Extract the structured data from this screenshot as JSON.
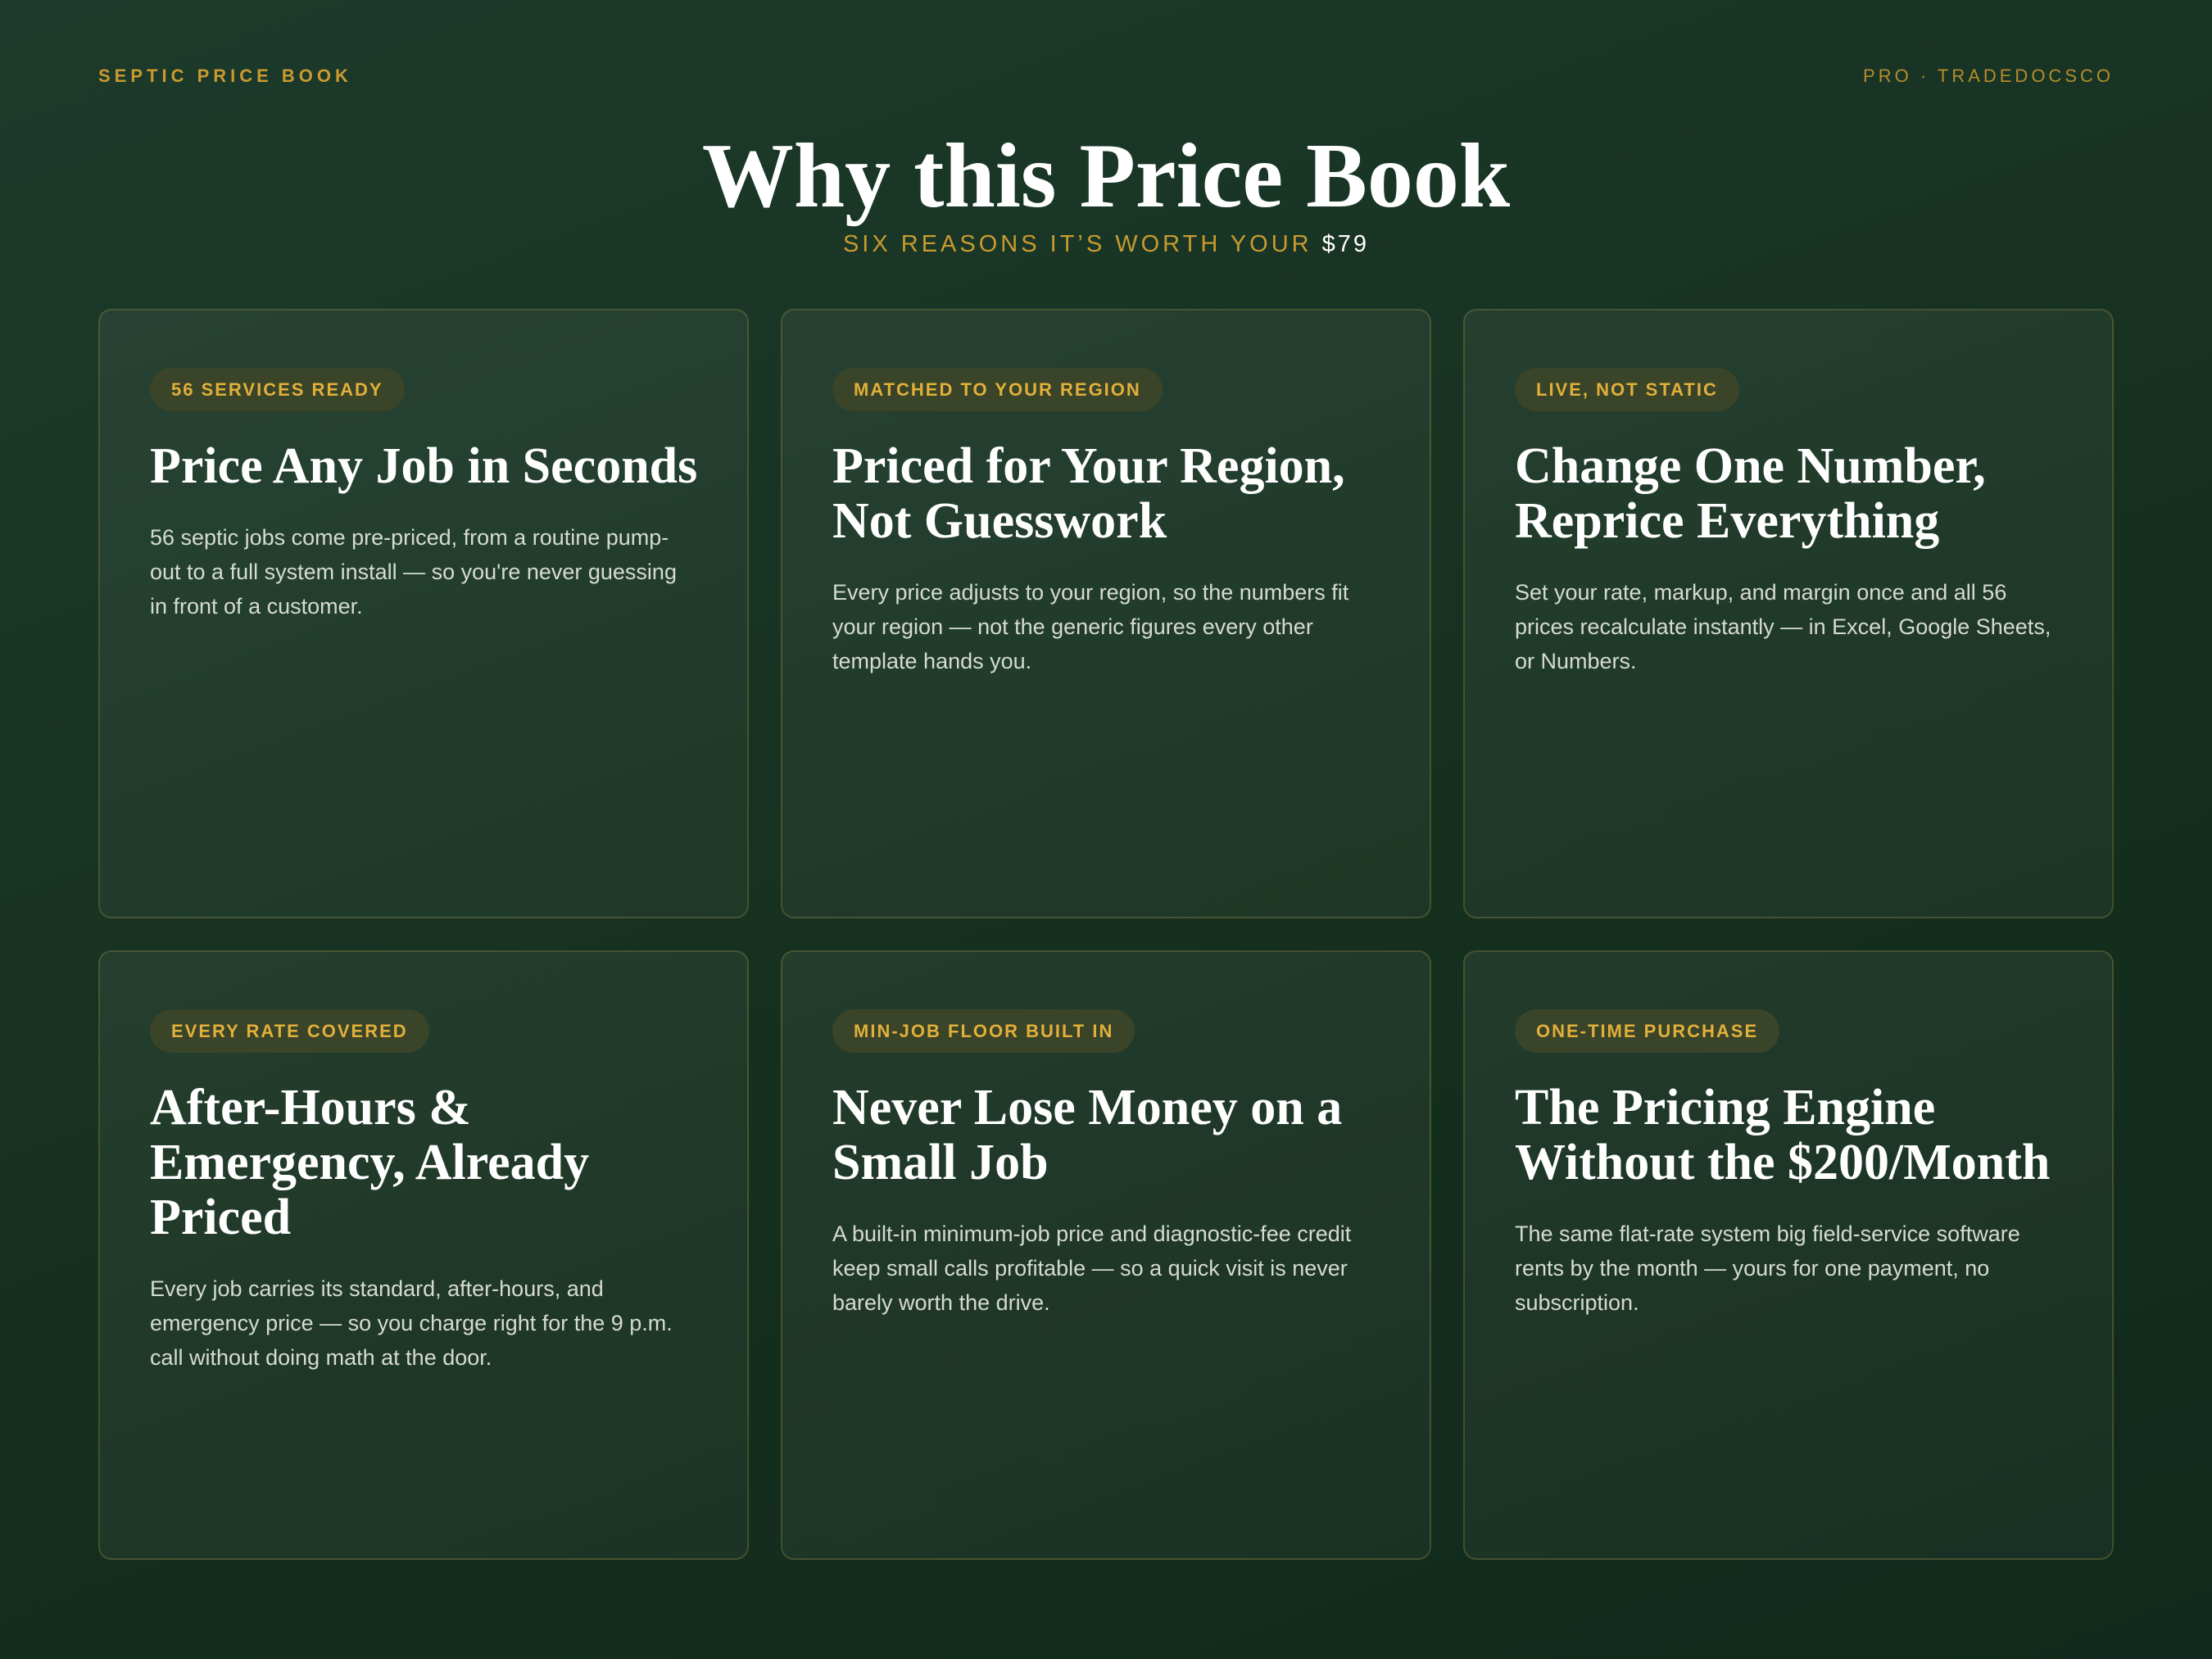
{
  "header": {
    "brand": "SEPTIC PRICE BOOK",
    "meta": "PRO · TRADEDOCSCO"
  },
  "hero": {
    "title": "Why this Price Book",
    "subtitle": "SIX REASONS IT’S WORTH YOUR",
    "price": "$79"
  },
  "colors": {
    "accent_gold": "#c99a2e",
    "badge_text": "#e2b03a",
    "background": "#1c3a2b"
  },
  "cards": [
    {
      "badge": "56 SERVICES READY",
      "title": "Price Any Job in Seconds",
      "body": "56 septic jobs come pre-priced, from a routine pump-out to a full system install — so you're never guessing in front of a customer."
    },
    {
      "badge": "MATCHED TO YOUR REGION",
      "title": "Priced for Your Region, Not Guesswork",
      "body": "Every price adjusts to your region, so the numbers fit your region — not the generic figures every other template hands you."
    },
    {
      "badge": "LIVE, NOT STATIC",
      "title": "Change One Number, Reprice Everything",
      "body": "Set your rate, markup, and margin once and all 56 prices recalculate instantly — in Excel, Google Sheets, or Numbers."
    },
    {
      "badge": "EVERY RATE COVERED",
      "title": "After-Hours & Emergency, Already Priced",
      "body": "Every job carries its standard, after-hours, and emergency price — so you charge right for the 9 p.m. call without doing math at the door."
    },
    {
      "badge": "MIN-JOB FLOOR BUILT IN",
      "title": "Never Lose Money on a Small Job",
      "body": "A built-in minimum-job price and diagnostic-fee credit keep small calls profitable — so a quick visit is never barely worth the drive."
    },
    {
      "badge": "ONE-TIME PURCHASE",
      "title": "The Pricing Engine Without the $200/Month",
      "body": "The same flat-rate system big field-service software rents by the month — yours for one payment, no subscription."
    }
  ]
}
